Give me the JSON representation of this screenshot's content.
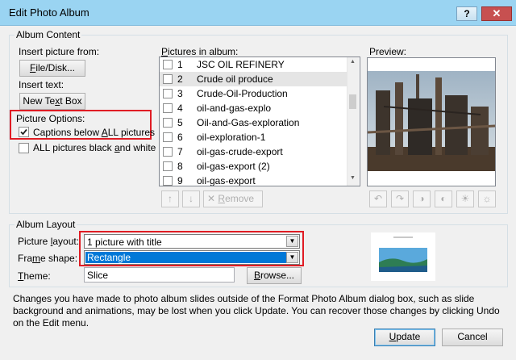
{
  "window": {
    "title": "Edit Photo Album",
    "help_glyph": "?",
    "close_glyph": "✕"
  },
  "album_content": {
    "group_label": "Album Content",
    "insert_picture_label": "Insert picture from:",
    "file_disk_button": {
      "pre": "",
      "key": "F",
      "post": "ile/Disk..."
    },
    "insert_text_label": "Insert text:",
    "new_text_box_button": {
      "pre": "New Te",
      "key": "x",
      "post": "t Box"
    },
    "picture_options_label": "Picture Options:",
    "captions_checkbox": {
      "pre": "Captions below ",
      "key": "A",
      "post": "LL pictures",
      "checked": true
    },
    "black_white_checkbox": {
      "pre": "ALL pictures black ",
      "key": "a",
      "post": "nd white",
      "checked": false
    },
    "pictures_label": {
      "pre": "",
      "key": "P",
      "post": "ictures in album:"
    },
    "pictures": [
      {
        "num": "1",
        "name": "JSC OIL REFINERY",
        "selected": false
      },
      {
        "num": "2",
        "name": "Crude oil produce",
        "selected": true
      },
      {
        "num": "3",
        "name": "Crude-Oil-Production",
        "selected": false
      },
      {
        "num": "4",
        "name": "oil-and-gas-explo",
        "selected": false
      },
      {
        "num": "5",
        "name": "Oil-and-Gas-exploration",
        "selected": false
      },
      {
        "num": "6",
        "name": "oil-exploration-1",
        "selected": false
      },
      {
        "num": "7",
        "name": "oil-gas-crude-export",
        "selected": false
      },
      {
        "num": "8",
        "name": "oil-gas-export (2)",
        "selected": false
      },
      {
        "num": "9",
        "name": "oil-gas-export",
        "selected": false
      }
    ],
    "move_up_glyph": "↑",
    "move_down_glyph": "↓",
    "remove_button": {
      "glyph": "✕",
      "pre": "",
      "key": "R",
      "post": "emove"
    },
    "preview_label": "Preview:",
    "rotate_ccw_glyph": "↶",
    "rotate_cw_glyph": "↷",
    "contrast_up_glyph": "◑",
    "contrast_down_glyph": "◐",
    "brightness_up_glyph": "☀",
    "brightness_down_glyph": "☼"
  },
  "album_layout": {
    "group_label": "Album Layout",
    "picture_layout_label": {
      "pre": "Picture ",
      "key": "l",
      "post": "ayout:"
    },
    "picture_layout_value": "1 picture with title",
    "frame_shape_label": {
      "pre": "Fra",
      "key": "m",
      "post": "e shape:"
    },
    "frame_shape_value": "Rectangle",
    "theme_label": {
      "pre": "",
      "key": "T",
      "post": "heme:"
    },
    "theme_value": "Slice",
    "browse_button": {
      "pre": "",
      "key": "B",
      "post": "rowse..."
    },
    "combo_arrow_glyph": "▼"
  },
  "footer": {
    "note": "Changes you have made to photo album slides outside of the Format Photo Album dialog box, such as slide background and animations, may be lost when you click Update. You can recover those changes by clicking Undo on the Edit menu.",
    "update_button": {
      "pre": "",
      "key": "U",
      "post": "pdate"
    },
    "cancel_button": "Cancel"
  }
}
